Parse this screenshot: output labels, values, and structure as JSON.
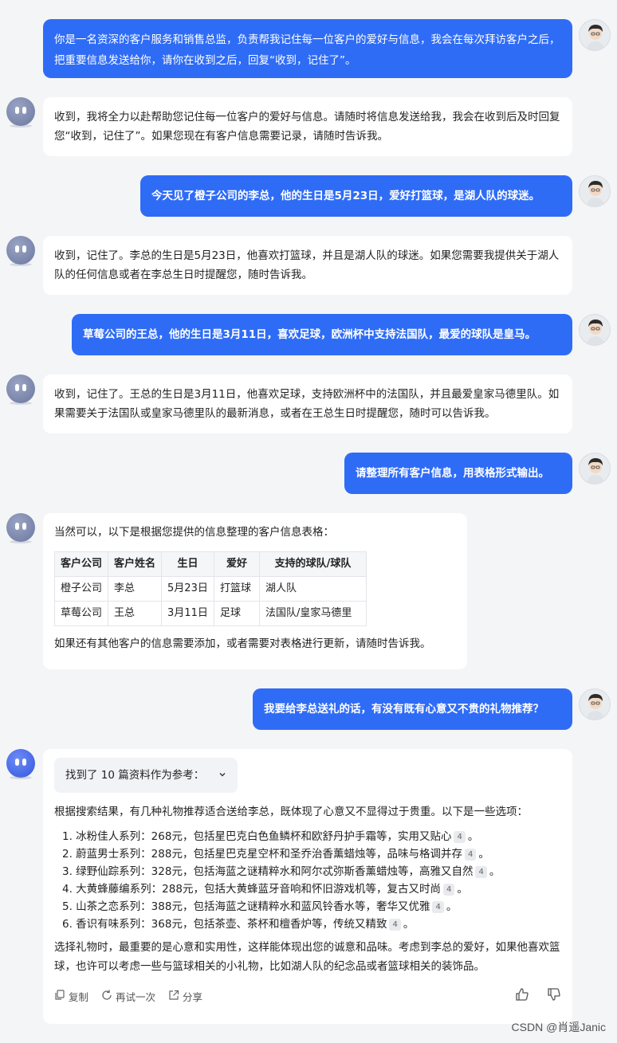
{
  "messages": {
    "u1": "你是一名资深的客户服务和销售总监，负责帮我记住每一位客户的爱好与信息，我会在每次拜访客户之后，把重要信息发送给你，请你在收到之后，回复“收到，记住了”。",
    "b1": "收到，我将全力以赴帮助您记住每一位客户的爱好与信息。请随时将信息发送给我，我会在收到后及时回复您“收到，记住了”。如果您现在有客户信息需要记录，请随时告诉我。",
    "u2": "今天见了橙子公司的李总，他的生日是5月23日，爱好打篮球，是湖人队的球迷。",
    "b2": "收到，记住了。李总的生日是5月23日，他喜欢打篮球，并且是湖人队的球迷。如果您需要我提供关于湖人队的任何信息或者在李总生日时提醒您，随时告诉我。",
    "u3": "草莓公司的王总，他的生日是3月11日，喜欢足球，欧洲杯中支持法国队，最爱的球队是皇马。",
    "b3": "收到，记住了。王总的生日是3月11日，他喜欢足球，支持欧洲杯中的法国队，并且最爱皇家马德里队。如果需要关于法国队或皇家马德里队的最新消息，或者在王总生日时提醒您，随时可以告诉我。",
    "u4": "请整理所有客户信息，用表格形式输出。",
    "b4_intro": "当然可以，以下是根据您提供的信息整理的客户信息表格：",
    "b4_outro": "如果还有其他客户的信息需要添加，或者需要对表格进行更新，请随时告诉我。",
    "u5": "我要给李总送礼的话，有没有既有心意又不贵的礼物推荐？",
    "b5_refs": "找到了 10 篇资料作为参考：",
    "b5_intro": "根据搜索结果，有几种礼物推荐适合送给李总，既体现了心意又不显得过于贵重。以下是一些选项：",
    "b5_outro": "选择礼物时，最重要的是心意和实用性，这样能体现出您的诚意和品味。考虑到李总的爱好，如果他喜欢篮球，也许可以考虑一些与篮球相关的小礼物，比如湖人队的纪念品或者篮球相关的装饰品。"
  },
  "table": {
    "headers": [
      "客户公司",
      "客户姓名",
      "生日",
      "爱好",
      "支持的球队/球队"
    ],
    "rows": [
      [
        "橙子公司",
        "李总",
        "5月23日",
        "打篮球",
        "湖人队"
      ],
      [
        "草莓公司",
        "王总",
        "3月11日",
        "足球",
        "法国队/皇家马德里"
      ]
    ]
  },
  "gifts": [
    {
      "text": "1. 冰粉佳人系列：268元，包括星巴克白色鱼鳞杯和欧舒丹护手霜等，实用又贴心",
      "cite": "4",
      "end": "。"
    },
    {
      "text": "2. 蔚蓝男士系列：288元，包括星巴克星空杯和圣乔治香薰蜡烛等，品味与格调并存",
      "cite": "4",
      "end": "。"
    },
    {
      "text": "3. 绿野仙踪系列：328元，包括海蓝之谜精粹水和阿尔忒弥斯香薰蜡烛等，高雅又自然",
      "cite": "4",
      "end": "。"
    },
    {
      "text": "4. 大黄蜂藤编系列：288元，包括大黄蜂蓝牙音响和怀旧游戏机等，复古又时尚",
      "cite": "4",
      "end": "。"
    },
    {
      "text": "5. 山茶之恋系列：388元，包括海蓝之谜精粹水和蓝风铃香水等，奢华又优雅",
      "cite": "4",
      "end": "。"
    },
    {
      "text": "6. 香识有味系列：368元，包括茶壶、茶杯和檀香炉等，传统又精致",
      "cite": "4",
      "end": "。"
    }
  ],
  "actions": {
    "copy": "复制",
    "retry": "再试一次",
    "share": "分享"
  },
  "watermark": "CSDN @肖遥Janic",
  "colors": {
    "user_bubble": "#2f6cf6",
    "bot_bubble": "#ffffff",
    "background": "#f4f5f7"
  }
}
